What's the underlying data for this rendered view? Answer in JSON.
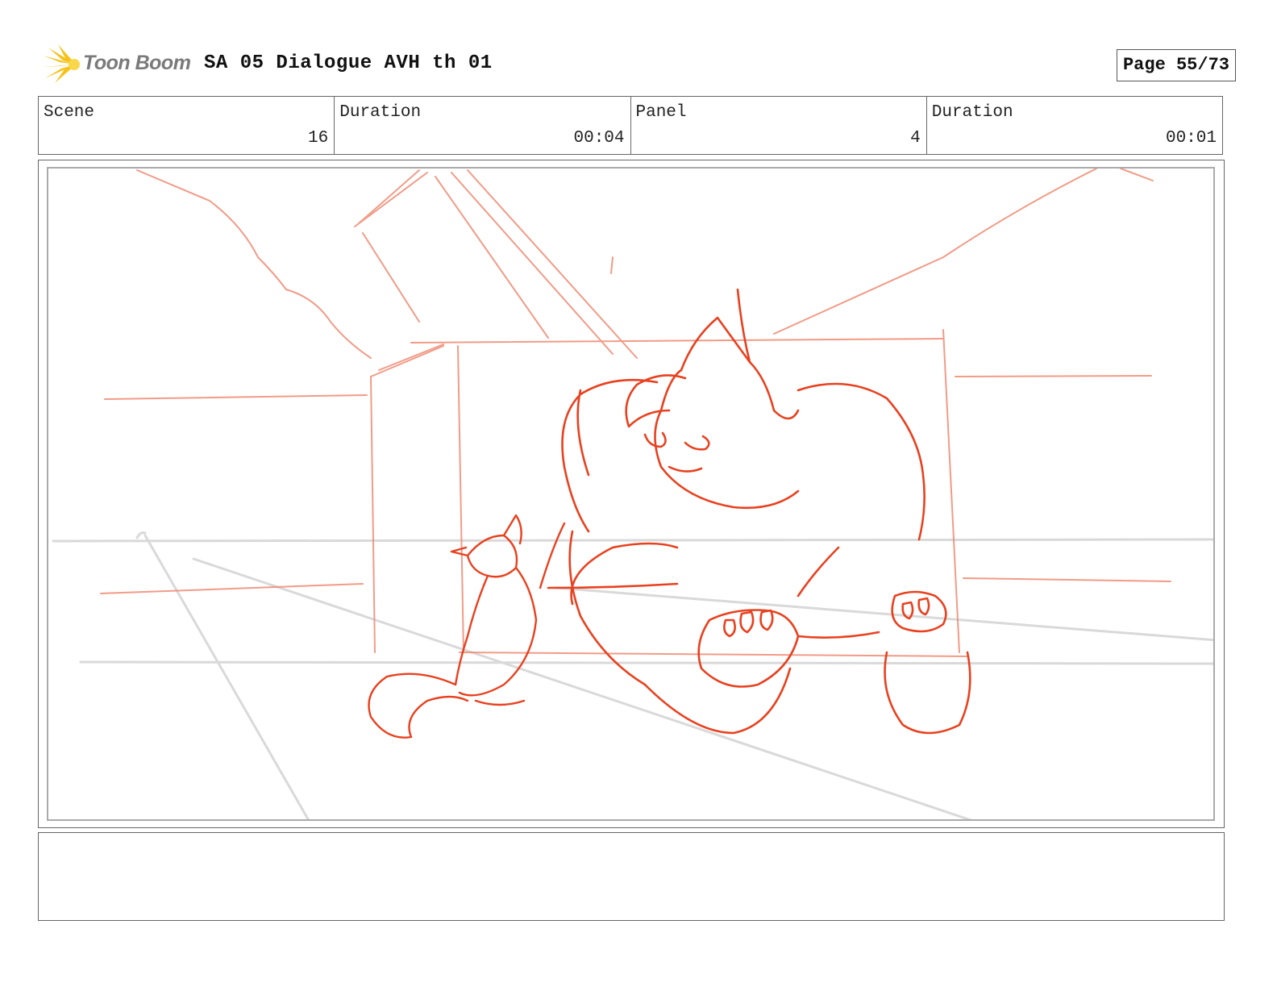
{
  "header": {
    "logo_text": "Toon Boom",
    "title": "SA 05 Dialogue AVH th 01",
    "page": "Page 55/73"
  },
  "info": {
    "scene_label": "Scene",
    "scene_value": "16",
    "scene_duration_label": "Duration",
    "scene_duration_value": "00:04",
    "panel_label": "Panel",
    "panel_value": "4",
    "panel_duration_label": "Duration",
    "panel_duration_value": "00:01"
  },
  "panel": {
    "content": "rough storyboard sketch of a large gorilla sitting inside a box with a small fox beside it",
    "sketch_color": "#e8411f",
    "guide_color": "#d6d6d6"
  },
  "notes": {
    "text": ""
  },
  "colors": {
    "logo_accent": "#f6c21a",
    "border": "#666666"
  }
}
